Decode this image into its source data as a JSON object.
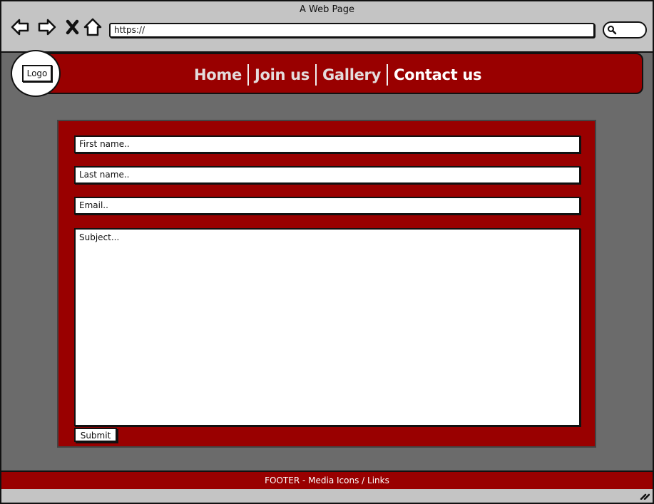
{
  "browser": {
    "window_title": "A Web Page",
    "url": "https://",
    "icons": [
      "back-arrow-icon",
      "forward-arrow-icon",
      "close-x-icon",
      "home-icon",
      "search-icon",
      "resize-grip-icon"
    ]
  },
  "header": {
    "logo_text": "Logo",
    "nav": [
      {
        "label": "Home"
      },
      {
        "label": "Join us"
      },
      {
        "label": "Gallery"
      },
      {
        "label": "Contact us",
        "active": true
      }
    ],
    "bar_color": "#990000"
  },
  "form": {
    "first_name_placeholder": "First name..",
    "last_name_placeholder": "Last name..",
    "email_placeholder": "Email..",
    "subject_placeholder": "Subject...",
    "submit_label": "Submit"
  },
  "footer": {
    "text": "FOOTER - Media Icons / Links"
  },
  "colors": {
    "brand_red": "#990000",
    "page_background": "#6b6b6b",
    "chrome_gray": "#c4c4c4"
  }
}
